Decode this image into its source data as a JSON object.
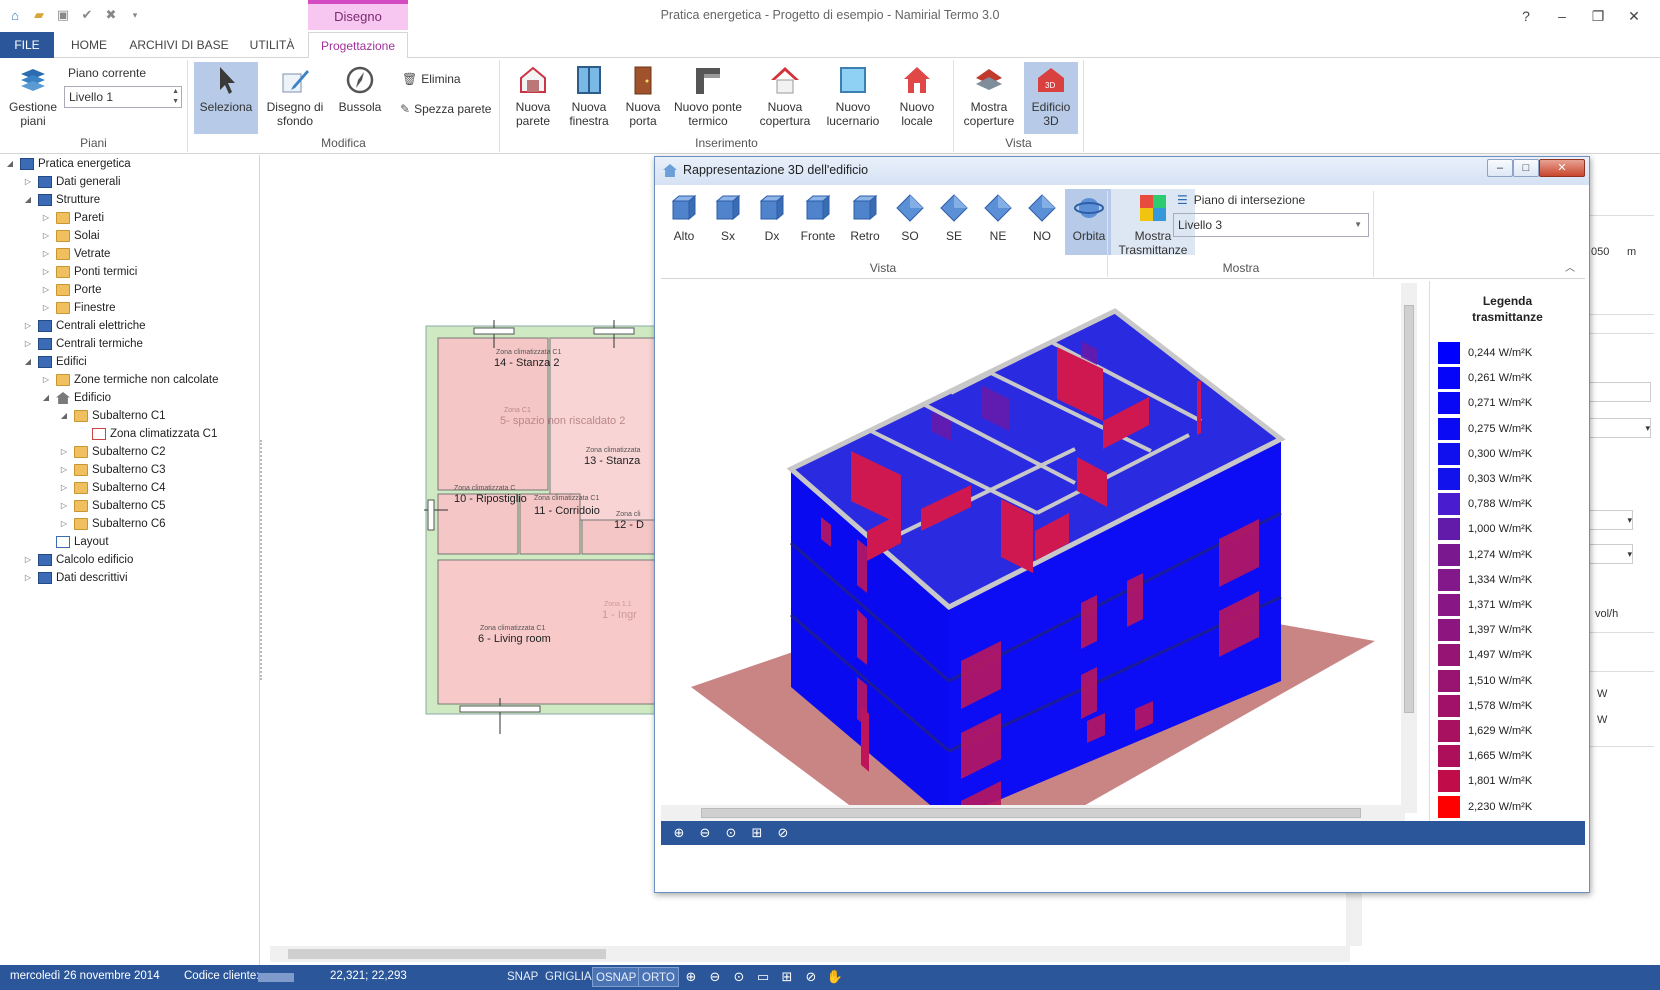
{
  "app": {
    "title": "Pratica energetica - Progetto di esempio - Namirial Termo 3.0",
    "context_group": "Disegno"
  },
  "window_controls": {
    "help": "?",
    "minimize": "–",
    "restore": "❐",
    "close": "✕"
  },
  "tabs": [
    "FILE",
    "HOME",
    "ARCHIVI DI BASE",
    "UTILITÀ",
    "Progettazione"
  ],
  "ribbon": {
    "piani": {
      "label": "Piani",
      "gestione": "Gestione piani",
      "piano_corrente_label": "Piano corrente",
      "piano_corrente_value": "Livello 1"
    },
    "modifica": {
      "label": "Modifica",
      "seleziona": "Seleziona",
      "disegno_sfondo": "Disegno di sfondo",
      "bussola": "Bussola",
      "elimina": "Elimina",
      "spezza": "Spezza parete"
    },
    "inserimento": {
      "label": "Inserimento",
      "nuova_parete": "Nuova parete",
      "nuova_finestra": "Nuova finestra",
      "nuova_porta": "Nuova porta",
      "nuovo_ponte": "Nuovo ponte termico",
      "nuova_copertura": "Nuova copertura",
      "nuovo_lucernario": "Nuovo lucernario",
      "nuovo_locale": "Nuovo locale"
    },
    "vista": {
      "label": "Vista",
      "mostra_coperture": "Mostra coperture",
      "edificio3d": "Edificio 3D"
    }
  },
  "tree": {
    "root": "Pratica energetica",
    "dati_generali": "Dati generali",
    "strutture": "Strutture",
    "pareti": "Pareti",
    "solai": "Solai",
    "vetrate": "Vetrate",
    "ponti_termici": "Ponti termici",
    "porte": "Porte",
    "finestre": "Finestre",
    "centrali_elettriche": "Centrali elettriche",
    "centrali_termiche": "Centrali termiche",
    "edifici": "Edifici",
    "zone_non_calcolate": "Zone termiche non calcolate",
    "edificio": "Edificio",
    "sub_c1": "Subalterno C1",
    "zona_c1": "Zona climatizzata C1",
    "sub_c2": "Subalterno C2",
    "sub_c3": "Subalterno C3",
    "sub_c4": "Subalterno C4",
    "sub_c5": "Subalterno C5",
    "sub_c6": "Subalterno C6",
    "layout": "Layout",
    "calcolo": "Calcolo edificio",
    "dati_descrittivi": "Dati descrittivi"
  },
  "plan": {
    "r14_zone": "Zona climatizzata C1",
    "r14": "14 - Stanza 2",
    "r5_zone": "Zona C1",
    "r5": "5- spazio non riscaldato 2",
    "r13_zone": "Zona climatizzata",
    "r13": "13 - Stanza",
    "r10_zone": "Zona climatizzata C",
    "r10": "10 - Ripostiglio",
    "r11_zone": "Zona climatizzata C1",
    "r11": "11 - Corridoio",
    "r12_zone": "Zona cli",
    "r12": "12 - D",
    "r6_zone": "Zona climatizzata C1",
    "r6": "6 - Living room",
    "r1_zone": "Zona 1.1",
    "r1": "1 - Ingr"
  },
  "props_frag": {
    "value": "050",
    "unit": "m",
    "unit2": "vol/h",
    "w1": "W",
    "w2": "W"
  },
  "dialog": {
    "title": "Rappresentazione 3D dell'edificio",
    "views": [
      "Alto",
      "Sx",
      "Dx",
      "Fronte",
      "Retro",
      "SO",
      "SE",
      "NE",
      "NO",
      "Orbita"
    ],
    "vista_label": "Vista",
    "mostra_trasmittanze": "Mostra Trasmittanze",
    "mostra_label": "Mostra",
    "piano_intersezione_label": "Piano di intersezione",
    "piano_intersezione_value": "Livello 3",
    "legend_title": "Legenda trasmittanze",
    "legend": [
      {
        "value": "0,244 W/m²K",
        "color": "#0000ff"
      },
      {
        "value": "0,261 W/m²K",
        "color": "#0505fa"
      },
      {
        "value": "0,271 W/m²K",
        "color": "#0808f6"
      },
      {
        "value": "0,275 W/m²K",
        "color": "#0a0af4"
      },
      {
        "value": "0,300 W/m²K",
        "color": "#1010ee"
      },
      {
        "value": "0,303 W/m²K",
        "color": "#1212ec"
      },
      {
        "value": "0,788 W/m²K",
        "color": "#4a1ccf"
      },
      {
        "value": "1,000 W/m²K",
        "color": "#621aa9"
      },
      {
        "value": "1,274 W/m²K",
        "color": "#7a1890"
      },
      {
        "value": "1,334 W/m²K",
        "color": "#82188a"
      },
      {
        "value": "1,371 W/m²K",
        "color": "#881685"
      },
      {
        "value": "1,397 W/m²K",
        "color": "#8c1580"
      },
      {
        "value": "1,497 W/m²K",
        "color": "#961474"
      },
      {
        "value": "1,510 W/m²K",
        "color": "#991370"
      },
      {
        "value": "1,578 W/m²K",
        "color": "#a1116a"
      },
      {
        "value": "1,629 W/m²K",
        "color": "#a81060"
      },
      {
        "value": "1,665 W/m²K",
        "color": "#ae0f5a"
      },
      {
        "value": "1,801 W/m²K",
        "color": "#c00c48"
      },
      {
        "value": "2,230 W/m²K",
        "color": "#ff0000"
      }
    ]
  },
  "status": {
    "date": "mercoledì 26 novembre 2014",
    "codice_cliente": "Codice cliente:",
    "coords": "22,321; 22,293",
    "snap": "SNAP",
    "griglia": "GRIGLIA",
    "osnap": "OSNAP",
    "orto": "ORTO"
  }
}
